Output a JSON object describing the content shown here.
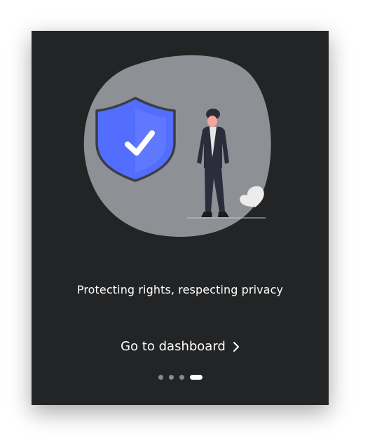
{
  "onboarding": {
    "tagline": "Protecting rights, respecting privacy",
    "cta_label": "Go to dashboard",
    "page_indicator": {
      "total": 4,
      "current": 4
    }
  },
  "illustration": {
    "icons": [
      "shield-check-icon",
      "person-figure",
      "heart-icon"
    ]
  },
  "colors": {
    "card_background": "#232425",
    "blob": "#8d9196",
    "shield": "#536dfe",
    "dot_inactive": "#8a8d90",
    "dot_active": "#ffffff",
    "text": "#ffffff"
  }
}
